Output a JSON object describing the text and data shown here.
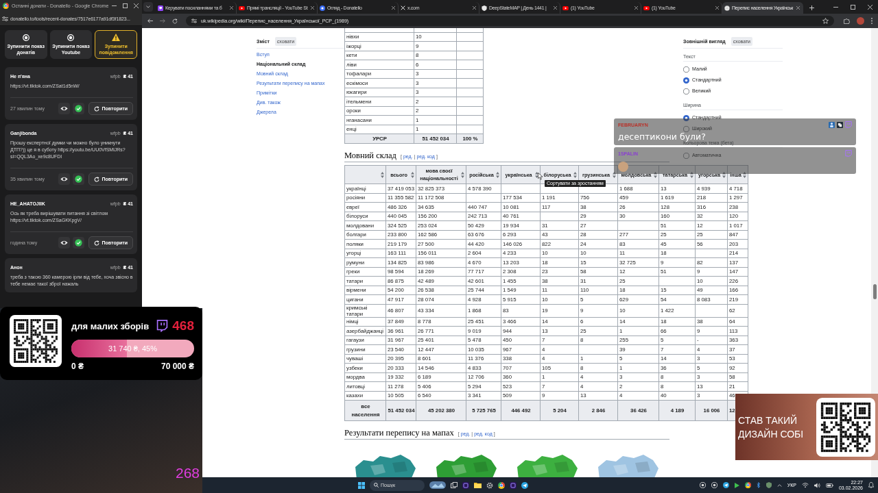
{
  "left_window": {
    "title": "Останні донати - Donatello - Google Chrome",
    "url": "donatello.to/tools/recent-donates/7517e6177a91df3f1823...",
    "controls": [
      {
        "kind": "stop",
        "label": "Зупинити показ донатів",
        "active": false
      },
      {
        "kind": "stop",
        "label": "Зупинити показ Youtube",
        "active": false
      },
      {
        "kind": "warning",
        "label": "Зупинити повідомлення",
        "active": true
      }
    ],
    "donations": [
      {
        "name": "Не п'яна",
        "source": "wfpb",
        "amount": "₴ 41",
        "message": "https://vt.tiktok.com/ZSat1d5nW/",
        "time": "27 хвилин тому",
        "action": "Повторити"
      },
      {
        "name": "Ganjibonda",
        "source": "wfpb",
        "amount": "₴ 41",
        "message": "Прошу експертної думки чи можно було уникнути ДТП?)) це я в суботу https://youtu.be/UU0VfSMlJRs?si=QQL3Ao_xe9c8UFDI",
        "time": "35 хвилин тому",
        "action": "Повторити"
      },
      {
        "name": "HE_AHATOJIIK",
        "source": "wfpb",
        "amount": "₴ 41",
        "message": "Ось як треба вирішувати питання зі світлом https://vt.tiktok.com/ZSaGKKpgV/",
        "time": "година тому",
        "action": "Повторити"
      },
      {
        "name": "Анон",
        "source": "wfpb",
        "amount": "₴ 41",
        "message": "треба з такою 360 камерою ірли від тебе, хоча звісно в тебе немає такої зброї нажаль"
      }
    ]
  },
  "browser": {
    "tabs": [
      {
        "kind": "chat",
        "title": "Керувати посиланнями та б",
        "selected": false
      },
      {
        "kind": "video",
        "title": "Прямі трансляції - YouTube St",
        "selected": false
      },
      {
        "kind": "donate",
        "title": "Огляд - Donatello",
        "selected": false
      },
      {
        "kind": "social",
        "title": "x.com",
        "selected": false
      },
      {
        "kind": "map",
        "title": "DeepStateMAP | День 1441 |",
        "selected": false
      },
      {
        "kind": "video",
        "title": "(1) YouTube",
        "selected": false
      },
      {
        "kind": "video",
        "title": "(1) YouTube",
        "selected": false
      },
      {
        "kind": "wiki",
        "title": "Перепис населення Українськ",
        "selected": true
      }
    ],
    "url": "uk.wikipedia.org/wiki/Перепис_населення_Української_РСР_(1989)"
  },
  "wiki": {
    "toc": {
      "title": "Зміст",
      "hide": "сховати",
      "items": [
        {
          "label": "Вступ",
          "selected": false
        },
        {
          "label": "Національний склад",
          "selected": true
        },
        {
          "label": "Мовний склад",
          "selected": false
        },
        {
          "label": "Результати перепису на мапах",
          "selected": false
        },
        {
          "label": "Примітки",
          "selected": false
        },
        {
          "label": "Див. також",
          "selected": false
        },
        {
          "label": "Джерела",
          "selected": false
        }
      ]
    },
    "nations_table": {
      "rows": [
        [
          "нівхи",
          "10",
          null
        ],
        [
          "іжорці",
          "9",
          null
        ],
        [
          "кети",
          "8",
          null
        ],
        [
          "ліви",
          "6",
          null
        ],
        [
          "тофалари",
          "3",
          null
        ],
        [
          "ескімоси",
          "3",
          null
        ],
        [
          "юкагири",
          "3",
          null
        ],
        [
          "ітельмени",
          "2",
          null
        ],
        [
          "ороки",
          "2",
          null
        ],
        [
          "нганасани",
          "1",
          null
        ],
        [
          "енці",
          "1",
          null
        ]
      ],
      "total": [
        "УРСР",
        "51 452 034",
        "100 %"
      ]
    },
    "language_section": {
      "heading": "Мовний склад",
      "edit_links": {
        "open": "[",
        "links": [
          "ред.",
          "ред. код"
        ],
        "separator": "|",
        "close": "]"
      },
      "columns": [
        null,
        "всього",
        "мова своєї національності",
        "російська",
        "українська",
        "білоруська",
        "грузинська",
        "молдовська",
        "татарська",
        "угорська",
        "інша"
      ],
      "rows": [
        [
          "українці",
          "37 419 053",
          "32 825 373",
          "4 578 390",
          null,
          null,
          null,
          "1 688",
          "13",
          "4 939",
          "4 718"
        ],
        [
          "росіяни",
          "11 355 582",
          "11 172 508",
          null,
          "177 534",
          "1 191",
          "756",
          "459",
          "1 619",
          "218",
          "1 297"
        ],
        [
          "євреї",
          "486 326",
          "34 635",
          "440 747",
          "10 081",
          "117",
          "38",
          "26",
          "128",
          "316",
          "238"
        ],
        [
          "білоруси",
          "440 045",
          "156 200",
          "242 713",
          "40 761",
          null,
          "29",
          "30",
          "160",
          "32",
          "120"
        ],
        [
          "молдовани",
          "324 525",
          "253 024",
          "50 429",
          "19 934",
          "31",
          "27",
          null,
          "51",
          "12",
          "1 017"
        ],
        [
          "болгари",
          "233 800",
          "162 586",
          "63 676",
          "6 293",
          "43",
          "28",
          "277",
          "25",
          "25",
          "847"
        ],
        [
          "поляки",
          "219 179",
          "27 500",
          "44 420",
          "146 026",
          "822",
          "24",
          "83",
          "45",
          "56",
          "203"
        ],
        [
          "угорці",
          "163 111",
          "156 011",
          "2 604",
          "4 233",
          "10",
          "10",
          "11",
          "18",
          null,
          "214"
        ],
        [
          "румуни",
          "134 825",
          "83 986",
          "4 670",
          "13 203",
          "18",
          "15",
          "32 725",
          "9",
          "82",
          "137"
        ],
        [
          "греки",
          "98 594",
          "18 269",
          "77 717",
          "2 308",
          "23",
          "58",
          "12",
          "51",
          "9",
          "147"
        ],
        [
          "татари",
          "86 875",
          "42 489",
          "42 601",
          "1 455",
          "38",
          "31",
          "25",
          null,
          "10",
          "226"
        ],
        [
          "вірмени",
          "54 200",
          "26 538",
          "25 744",
          "1 549",
          "11",
          "110",
          "18",
          "15",
          "49",
          "166"
        ],
        [
          "цигани",
          "47 917",
          "28 074",
          "4 928",
          "5 915",
          "10",
          "5",
          "629",
          "54",
          "8 083",
          "219"
        ],
        [
          "кримські татари",
          "46 807",
          "43 334",
          "1 868",
          "83",
          "19",
          "9",
          "10",
          "1 422",
          null,
          "62"
        ],
        [
          "німці",
          "37 849",
          "8 778",
          "25 451",
          "3 466",
          "14",
          "6",
          "14",
          "18",
          "38",
          "64"
        ],
        [
          "азербайджанці",
          "36 961",
          "26 771",
          "9 019",
          "944",
          "13",
          "25",
          "1",
          "66",
          "9",
          "113"
        ],
        [
          "гагаузи",
          "31 967",
          "25 401",
          "5 478",
          "450",
          "7",
          "8",
          "255",
          "5",
          "-",
          "363"
        ],
        [
          "грузини",
          "23 540",
          "12 447",
          "10 035",
          "967",
          "4",
          null,
          "39",
          "7",
          "4",
          "37"
        ],
        [
          "чуваші",
          "20 395",
          "8 601",
          "11 376",
          "338",
          "4",
          "1",
          "5",
          "14",
          "3",
          "53"
        ],
        [
          "узбеки",
          "20 333",
          "14 546",
          "4 833",
          "707",
          "105",
          "8",
          "1",
          "36",
          "5",
          "92"
        ],
        [
          "мордва",
          "19 332",
          "6 189",
          "12 706",
          "360",
          "1",
          "4",
          "3",
          "8",
          "3",
          "58"
        ],
        [
          "литовці",
          "11 278",
          "5 406",
          "5 294",
          "523",
          "7",
          "4",
          "2",
          "8",
          "13",
          "21"
        ],
        [
          "казахи",
          "10 505",
          "6 540",
          "3 341",
          "509",
          "9",
          "13",
          "4",
          "40",
          "3",
          "46"
        ]
      ],
      "total": [
        "все населення",
        "51 452 034",
        "45 202 380",
        "5 725 765",
        "446 492",
        "5 204",
        "2 846",
        "36 426",
        "4 189",
        "16 006",
        "12"
      ],
      "tooltip": "Сортувати за зростанням"
    },
    "maps_section": {
      "heading": "Результати перепису на мапах",
      "edit_links": {
        "open": "[",
        "links": [
          "ред.",
          "ред. код"
        ],
        "separator": "|",
        "close": "]"
      },
      "maps": [
        {
          "color": "#2a8f8f"
        },
        {
          "color": "#2e9e35"
        },
        {
          "color": "#3db040"
        },
        {
          "color": "#9fc4e2"
        }
      ]
    }
  },
  "appearance": {
    "title": "Зовнішній вигляд",
    "hide": "сховати",
    "groups": [
      {
        "label": "Текст",
        "options": [
          {
            "label": "Малий",
            "selected": false
          },
          {
            "label": "Стандартний",
            "selected": true
          },
          {
            "label": "Великий",
            "selected": false
          }
        ]
      },
      {
        "label": "Ширина",
        "options": [
          {
            "label": "Стандартний",
            "selected": true
          },
          {
            "label": "Широкий",
            "selected": false
          }
        ]
      },
      {
        "label": "Кольорова тема (бета)",
        "options": [
          {
            "label": "Автоматична",
            "selected": false
          }
        ]
      }
    ]
  },
  "chat": [
    {
      "kind": "text",
      "user": "FEBRUARYN",
      "color": "#b8322a",
      "has_badges": true,
      "message": "десептикони були?"
    },
    {
      "kind": "emote",
      "user": "1SPALIN",
      "color": "#8a3fd1",
      "has_badges": false
    }
  ],
  "goal": {
    "title": "для малих зборів",
    "count": "468",
    "level": 0.45,
    "reading": "31 740 ₴, 45%",
    "min": "0 ₴",
    "max": "70 000 ₴"
  },
  "webcam": {
    "counter": "268"
  },
  "promo": {
    "text": "СТАВ ТАКИЙ ДИЗАЙН СОБІ"
  },
  "taskbar": {
    "search": {
      "placeholder": "Пошук"
    },
    "language": "УКР",
    "time": "22:27",
    "date": "03.02.2026"
  }
}
